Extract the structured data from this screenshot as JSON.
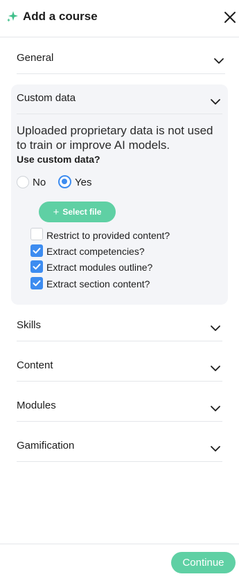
{
  "header": {
    "title": "Add a course",
    "icon": "sparkle-icon",
    "close_icon": "close-icon"
  },
  "sections": {
    "general": "General",
    "custom_data": "Custom data",
    "skills": "Skills",
    "content": "Content",
    "modules": "Modules",
    "gamification": "Gamification"
  },
  "custom_data": {
    "description": "Uploaded proprietary data is not used to train or improve AI models.",
    "use_label": "Use custom data?",
    "radio_no": "No",
    "radio_yes": "Yes",
    "selected": "Yes",
    "select_file_label": "Select file",
    "options": [
      {
        "label": "Restrict to provided content?",
        "checked": false
      },
      {
        "label": "Extract competencies?",
        "checked": true
      },
      {
        "label": "Extract modules outline?",
        "checked": true
      },
      {
        "label": "Extract section content?",
        "checked": true
      }
    ]
  },
  "footer": {
    "continue_label": "Continue"
  },
  "colors": {
    "accent_green": "#5fd0a4",
    "accent_blue": "#3d8cf0",
    "panel_bg": "#f4f5f8",
    "divider": "#e4e6ea"
  }
}
